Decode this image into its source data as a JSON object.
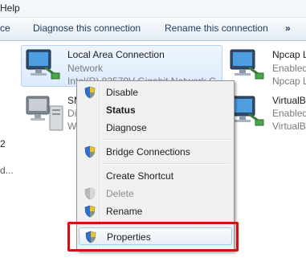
{
  "menubar": {
    "help": "Help"
  },
  "commandbar": {
    "items": [
      "ce",
      "Diagnose this connection",
      "Rename this connection",
      "»"
    ]
  },
  "adapters": [
    {
      "name": "Local Area Connection",
      "line2": "Network",
      "line3": "Intel(R) 82579V Gigabit Network C..."
    },
    {
      "name": "Npcap L",
      "line2": "Enabled",
      "line3": "Npcap L"
    },
    {
      "name": "SM",
      "line2": "Di",
      "line3": "W"
    },
    {
      "name": "VirtualBo",
      "line2": "Enabled",
      "line3": "VirtualBo"
    }
  ],
  "left_edge": {
    "digit": "2",
    "ellipsis": "d..."
  },
  "context_menu": {
    "items": [
      {
        "label": "Disable",
        "icon": "shield-icon"
      },
      {
        "label": "Status",
        "bold": true
      },
      {
        "label": "Diagnose"
      },
      {
        "label": "Bridge Connections",
        "icon": "shield-icon"
      },
      {
        "label": "Create Shortcut"
      },
      {
        "label": "Delete",
        "icon": "shield-icon",
        "disabled": true
      },
      {
        "label": "Rename",
        "icon": "shield-icon"
      },
      {
        "label": "Properties",
        "icon": "shield-icon",
        "highlighted": true
      }
    ]
  },
  "colors": {
    "highlight_border": "#d60f12",
    "selection": "#dcebfc"
  }
}
